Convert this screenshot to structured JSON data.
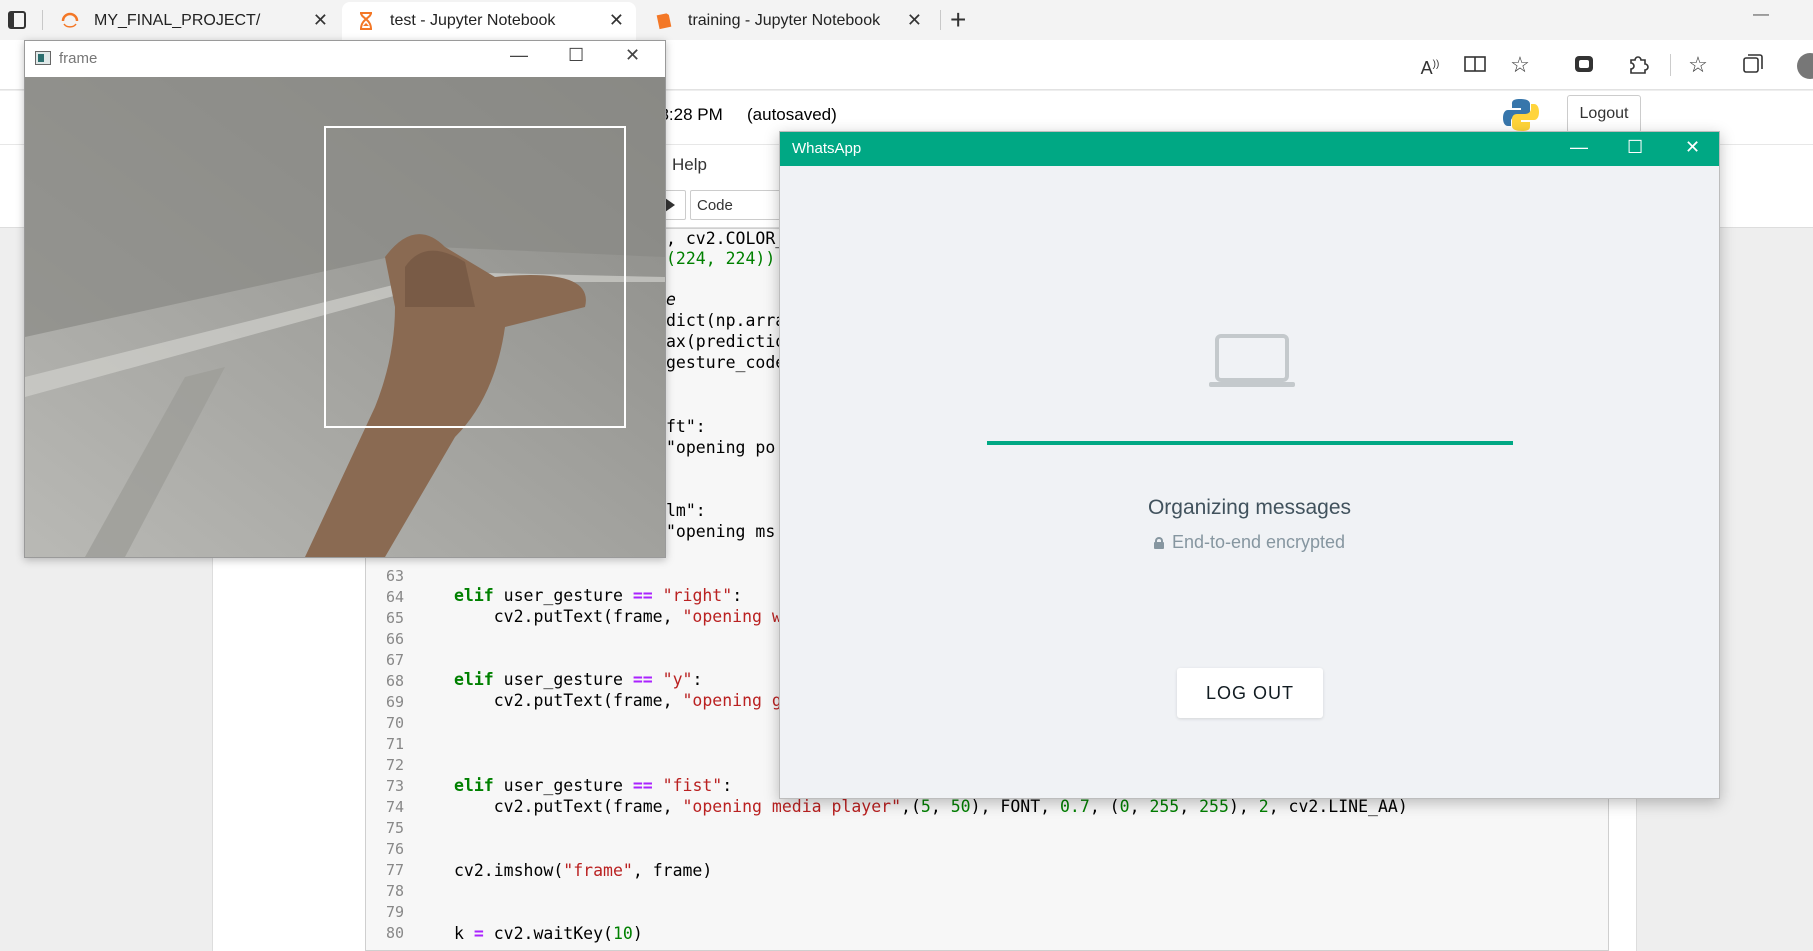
{
  "browser": {
    "tabs": [
      {
        "label": "MY_FINAL_PROJECT/",
        "icon": "jupyter-loading-icon"
      },
      {
        "label": "test - Jupyter Notebook",
        "icon": "hourglass-icon"
      },
      {
        "label": "training - Jupyter Notebook",
        "icon": "notebook-icon"
      }
    ],
    "new_tab": "+",
    "close": "✕",
    "minimize": "—"
  },
  "jupyter": {
    "save_status": "t 8:28 PM",
    "autosaved": "(autosaved)",
    "logout": "Logout",
    "menu_help": "Help",
    "cell_type": "Code",
    "line_numbers": [
      "63",
      "64",
      "65",
      "66",
      "67",
      "68",
      "69",
      "70",
      "71",
      "72",
      "73",
      "74",
      "75",
      "76",
      "77",
      "78",
      "79",
      "80"
    ],
    "partial_lines": [
      {
        "text": ", cv2.COLOR_"
      },
      {
        "text": "(224, 224))"
      },
      {
        "text": "e"
      },
      {
        "text": "dict(np.arra"
      },
      {
        "text": "ax(predictio"
      },
      {
        "text": "gesture_code"
      },
      {
        "text": "ft\":"
      },
      {
        "text": "\"opening po"
      },
      {
        "text": "lm\":"
      },
      {
        "text": "\"opening ms"
      }
    ],
    "code": {
      "l64_kw": "elif",
      "l64_a": " user_gesture ",
      "l64_op": "==",
      "l64_str": " \"right\"",
      "l64_end": ":",
      "l65_a": "    cv2.putText(frame, ",
      "l65_str": "\"opening wh",
      "l68_kw": "elif",
      "l68_a": " user_gesture ",
      "l68_op": "==",
      "l68_str": " \"y\"",
      "l68_end": ":",
      "l69_a": "    cv2.putText(frame, ",
      "l69_str": "\"opening go",
      "l73_kw": "elif",
      "l73_a": " user_gesture ",
      "l73_op": "==",
      "l73_str": " \"fist\"",
      "l73_end": ":",
      "l74_a": "    cv2.putText(frame, ",
      "l74_str": "\"opening media player\"",
      "l74_b": ",(",
      "l74_n1": "5",
      "l74_c": ", ",
      "l74_n2": "50",
      "l74_d": "), FONT, ",
      "l74_n3": "0.7",
      "l74_e": ", (",
      "l74_n4": "0",
      "l74_f": ", ",
      "l74_n5": "255",
      "l74_g": ", ",
      "l74_n6": "255",
      "l74_h": "), ",
      "l74_n7": "2",
      "l74_i": ", cv2.LINE_AA)",
      "l77_a": "cv2.imshow(",
      "l77_str": "\"frame\"",
      "l77_b": ", frame)",
      "l80_a": "k ",
      "l80_op": "=",
      "l80_b": " cv2.waitKey(",
      "l80_n": "10",
      "l80_c": ")"
    }
  },
  "frame_window": {
    "title": "frame",
    "minimize": "—",
    "maximize": "☐",
    "close": "✕"
  },
  "whatsapp": {
    "title": "WhatsApp",
    "status": "Organizing messages",
    "encryption": "End-to-end encrypted",
    "logout": "LOG OUT",
    "progress": 1.0,
    "accent": "#00a884"
  }
}
